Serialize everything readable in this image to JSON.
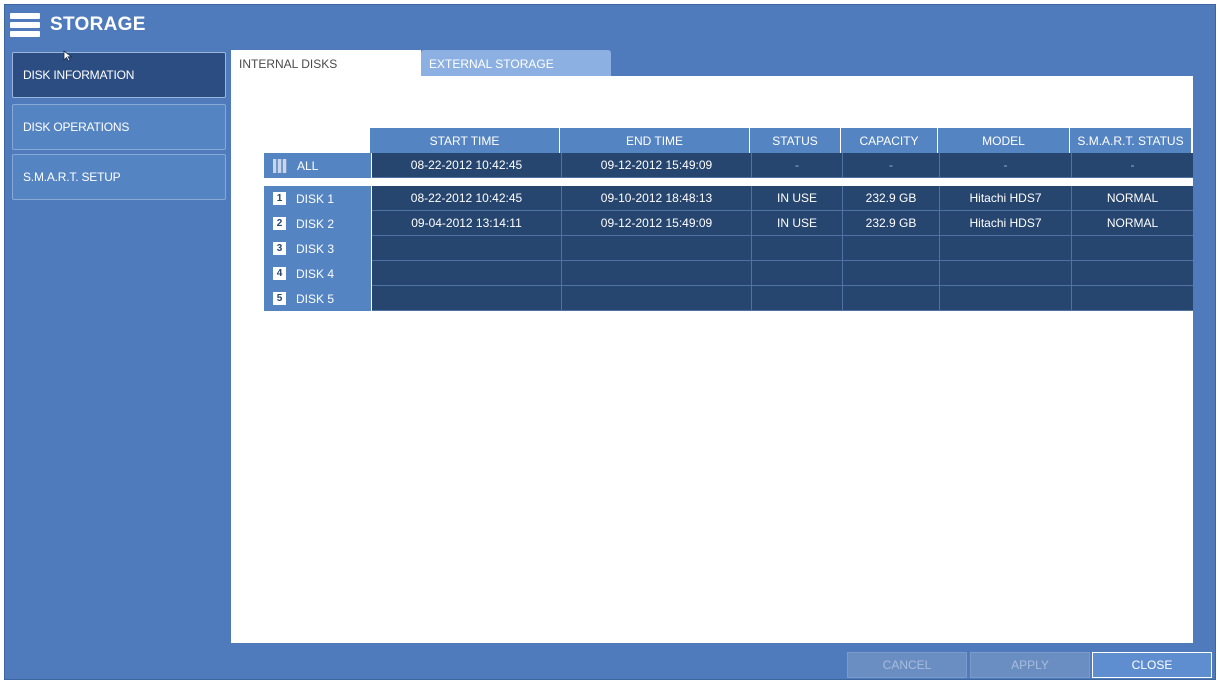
{
  "title": "STORAGE",
  "sidebar": {
    "items": [
      {
        "label": "DISK INFORMATION"
      },
      {
        "label": "DISK OPERATIONS"
      },
      {
        "label": "S.M.A.R.T. SETUP"
      }
    ]
  },
  "tabs": [
    {
      "label": "INTERNAL DISKS"
    },
    {
      "label": "EXTERNAL STORAGE"
    }
  ],
  "table": {
    "headers": [
      "START TIME",
      "END TIME",
      "STATUS",
      "CAPACITY",
      "MODEL",
      "S.M.A.R.T. STATUS"
    ],
    "all_row": {
      "label": "ALL",
      "cells": [
        "08-22-2012  10:42:45",
        "09-12-2012  15:49:09",
        "-",
        "-",
        "-",
        "-"
      ]
    },
    "disk_rows": [
      {
        "num": "1",
        "label": "DISK 1",
        "cells": [
          "08-22-2012  10:42:45",
          "09-10-2012  18:48:13",
          "IN USE",
          "232.9 GB",
          "Hitachi HDS7",
          "NORMAL"
        ]
      },
      {
        "num": "2",
        "label": "DISK 2",
        "cells": [
          "09-04-2012  13:14:11",
          "09-12-2012  15:49:09",
          "IN USE",
          "232.9 GB",
          "Hitachi HDS7",
          "NORMAL"
        ]
      },
      {
        "num": "3",
        "label": "DISK 3",
        "cells": [
          "",
          "",
          "",
          "",
          "",
          ""
        ]
      },
      {
        "num": "4",
        "label": "DISK 4",
        "cells": [
          "",
          "",
          "",
          "",
          "",
          ""
        ]
      },
      {
        "num": "5",
        "label": "DISK 5",
        "cells": [
          "",
          "",
          "",
          "",
          "",
          ""
        ]
      }
    ]
  },
  "buttons": {
    "cancel": "CANCEL",
    "apply": "APPLY",
    "close": "CLOSE"
  },
  "colors": {
    "background": "#4f7bbd",
    "header": "#5584c3",
    "data_cell": "#26456f"
  }
}
